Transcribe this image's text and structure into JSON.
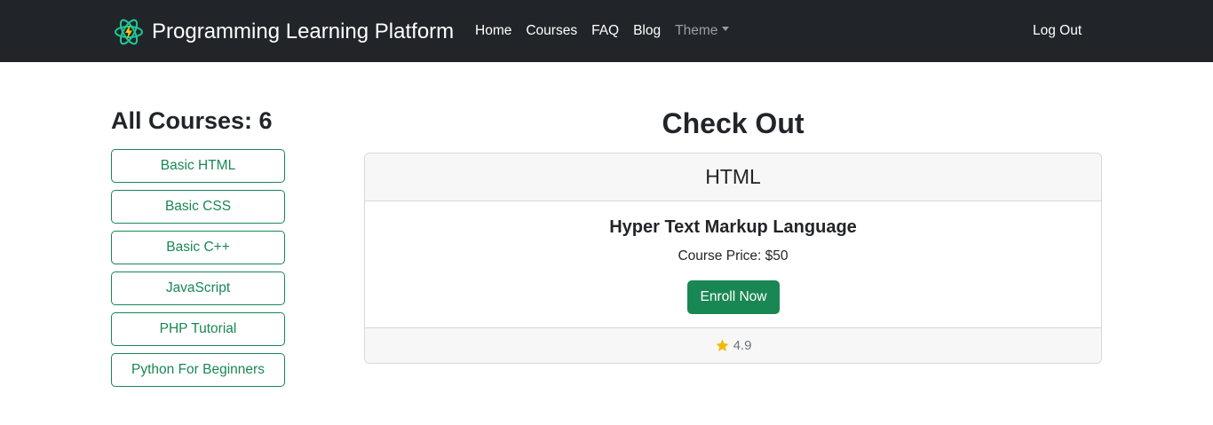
{
  "navbar": {
    "brand": "Programming Learning Platform",
    "brand_icon": "atom-lightning-icon",
    "links": [
      "Home",
      "Courses",
      "FAQ",
      "Blog"
    ],
    "theme_label": "Theme",
    "logout_label": "Log Out"
  },
  "sidebar": {
    "title": "All Courses: 6",
    "courses": [
      "Basic HTML",
      "Basic CSS",
      "Basic C++",
      "JavaScript",
      "PHP Tutorial",
      "Python For Beginners"
    ]
  },
  "main": {
    "title": "Check Out",
    "card": {
      "header": "HTML",
      "course_name": "Hyper Text Markup Language",
      "price_label": "Course Price:",
      "price_value": "$50",
      "enroll_label": "Enroll Now",
      "rating": "4.9",
      "rating_icon": "star-icon"
    }
  },
  "colors": {
    "navbar_bg": "#212529",
    "accent_green": "#198754",
    "star": "#f5b800"
  }
}
